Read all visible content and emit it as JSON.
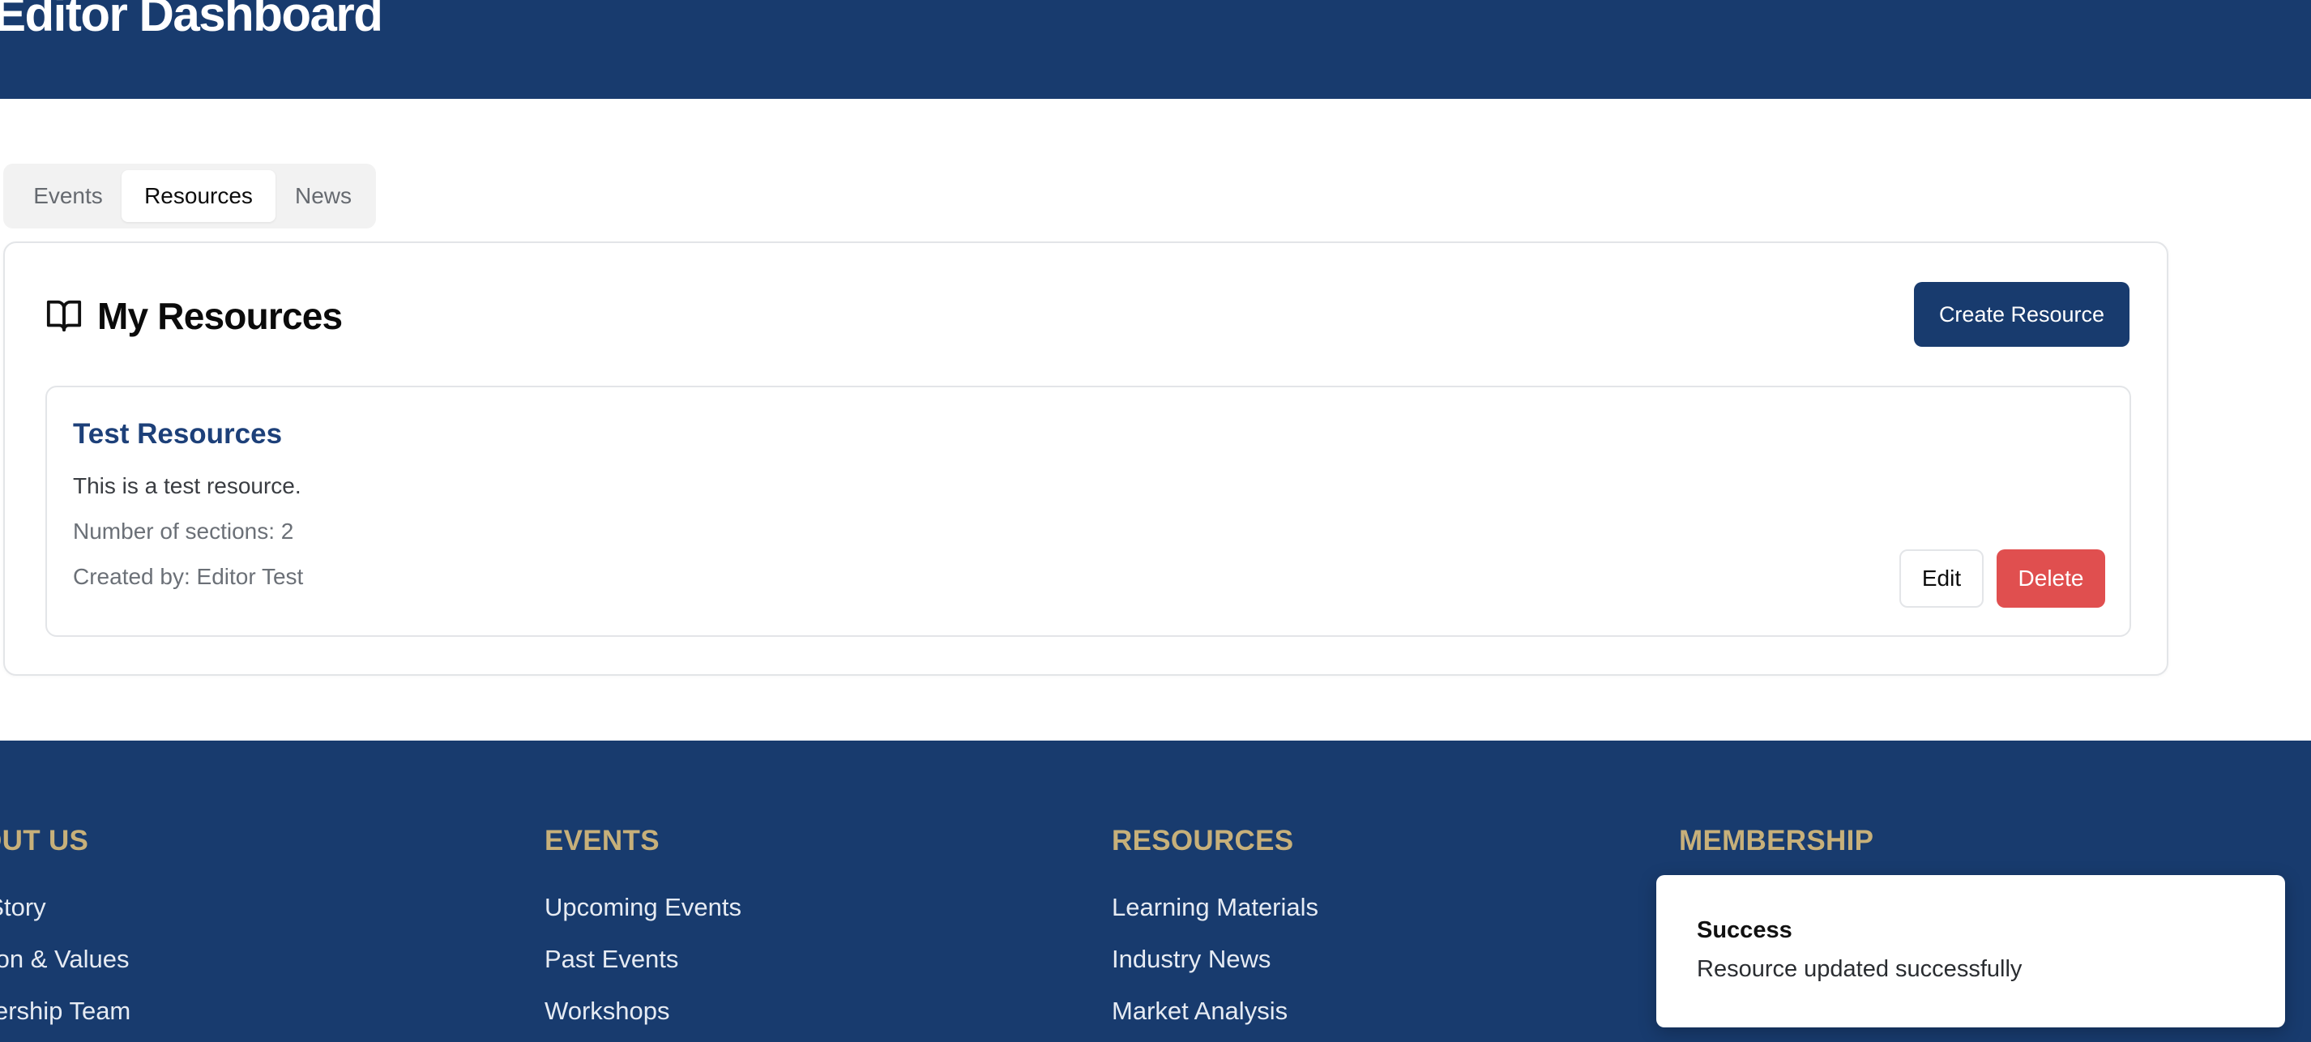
{
  "header": {
    "title": "Editor Dashboard"
  },
  "tabs": [
    {
      "label": "Events",
      "active": false
    },
    {
      "label": "Resources",
      "active": true
    },
    {
      "label": "News",
      "active": false
    }
  ],
  "main": {
    "icon": "book-open-icon",
    "title": "My Resources",
    "create_button_label": "Create Resource",
    "resources": [
      {
        "title": "Test Resources",
        "description": "This is a test resource.",
        "sections_text": "Number of sections: 2",
        "creator_text": "Created by: Editor Test",
        "edit_label": "Edit",
        "delete_label": "Delete"
      }
    ]
  },
  "footer": {
    "columns": [
      {
        "heading": "ABOUT US",
        "links": [
          "Our Story",
          "Mission & Values",
          "Leadership Team"
        ]
      },
      {
        "heading": "EVENTS",
        "links": [
          "Upcoming Events",
          "Past Events",
          "Workshops"
        ]
      },
      {
        "heading": "RESOURCES",
        "links": [
          "Learning Materials",
          "Industry News",
          "Market Analysis"
        ]
      },
      {
        "heading": "MEMBERSHIP",
        "links": []
      }
    ]
  },
  "toast": {
    "title": "Success",
    "message": "Resource updated successfully"
  },
  "colors": {
    "brand_navy": "#183b6e",
    "accent_gold": "#c7b07a",
    "danger_red": "#e04f4f",
    "link_blue": "#1d4079"
  }
}
